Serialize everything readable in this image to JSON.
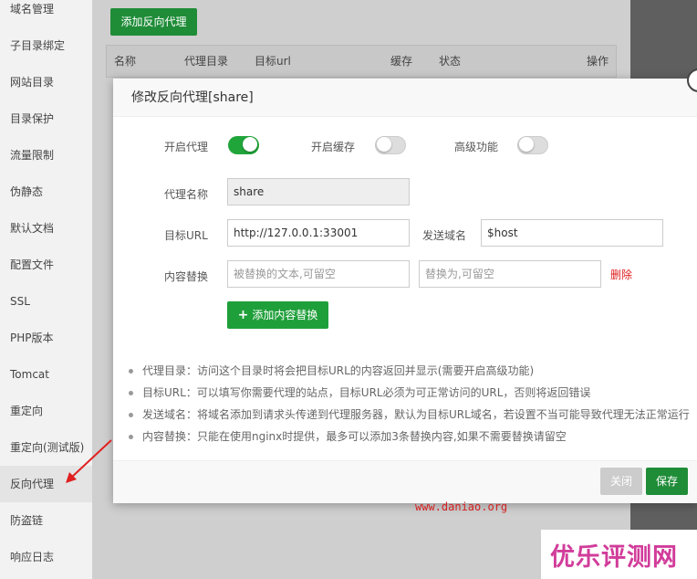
{
  "sidebar": {
    "items": [
      {
        "label": "域名管理"
      },
      {
        "label": "子目录绑定"
      },
      {
        "label": "网站目录"
      },
      {
        "label": "目录保护"
      },
      {
        "label": "流量限制"
      },
      {
        "label": "伪静态"
      },
      {
        "label": "默认文档"
      },
      {
        "label": "配置文件"
      },
      {
        "label": "SSL"
      },
      {
        "label": "PHP版本"
      },
      {
        "label": "Tomcat"
      },
      {
        "label": "重定向"
      },
      {
        "label": "重定向(测试版)"
      },
      {
        "label": "反向代理"
      },
      {
        "label": "防盗链"
      },
      {
        "label": "响应日志"
      }
    ],
    "active_index": 13
  },
  "background": {
    "add_button": "添加反向代理",
    "table_headers": [
      "名称",
      "代理目录",
      "目标url",
      "缓存",
      "状态",
      "操作"
    ]
  },
  "modal": {
    "title": "修改反向代理[share]",
    "toggles": {
      "proxy_label": "开启代理",
      "proxy_on": true,
      "cache_label": "开启缓存",
      "cache_on": false,
      "advanced_label": "高级功能",
      "advanced_on": false
    },
    "proxy_name_label": "代理名称",
    "proxy_name_value": "share",
    "target_url_label": "目标URL",
    "target_url_value": "http://127.0.0.1:33001",
    "send_domain_label": "发送域名",
    "send_domain_value": "$host",
    "content_replace_label": "内容替换",
    "replace_from_placeholder": "被替换的文本,可留空",
    "replace_to_placeholder": "替换为,可留空",
    "delete_label": "删除",
    "add_replace_button": "添加内容替换",
    "notes": [
      "代理目录：访问这个目录时将会把目标URL的内容返回并显示(需要开启高级功能)",
      "目标URL：可以填写你需要代理的站点，目标URL必须为可正常访问的URL，否则将返回错误",
      "发送域名：将域名添加到请求头传递到代理服务器，默认为目标URL域名，若设置不当可能导致代理无法正常运行",
      "内容替换：只能在使用nginx时提供，最多可以添加3条替换内容,如果不需要替换请留空"
    ],
    "close_button": "关闭",
    "save_button": "保存"
  },
  "watermark": {
    "url": "www.daniao.org",
    "brand": "优乐评测网"
  },
  "colors": {
    "accent_green": "#20a53a",
    "delete_red": "#e02020",
    "brand_pink": "#d13c9a"
  }
}
